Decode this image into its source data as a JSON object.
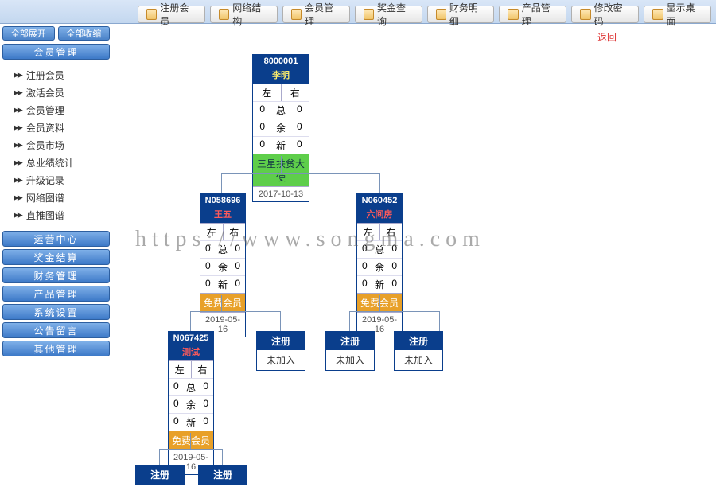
{
  "top": [
    "注册会员",
    "网络结构",
    "会员管理",
    "奖金查询",
    "财务明细",
    "产品管理",
    "修改密码",
    "显示桌面"
  ],
  "expand": "全部展开",
  "collapse": "全部收缩",
  "sec1": "会员管理",
  "menu1": [
    "注册会员",
    "激活会员",
    "会员管理",
    "会员资料",
    "会员市场",
    "总业绩统计",
    "升级记录",
    "网络图谱",
    "直推图谱"
  ],
  "sec2": "运营中心",
  "menu2": [
    "奖金结算",
    "财务管理",
    "产品管理",
    "系统设置",
    "公告留言",
    "其他管理"
  ],
  "back": "返回",
  "lbl": {
    "left": "左",
    "right": "右",
    "zong": "总",
    "yu": "余",
    "xin": "新",
    "reg": "注册",
    "nojoin": "未加入"
  },
  "root": {
    "id": "8000001",
    "name": "李明",
    "l0": "0",
    "r0": "0",
    "l1": "0",
    "r1": "0",
    "l2": "0",
    "r2": "0",
    "level": "三星扶贫大使",
    "date": "2017-10-13"
  },
  "n1": {
    "id": "N058696",
    "name": "王五",
    "l0": "0",
    "m0": "总",
    "r0": "0",
    "l1": "0",
    "m1": "余",
    "r1": "0",
    "l2": "0",
    "m2": "新",
    "r2": "0",
    "level": "免费会员",
    "date": "2019-05-16"
  },
  "n2": {
    "id": "N060452",
    "name": "六间房",
    "date": "2019-05-16",
    "level": "免费会员"
  },
  "n3": {
    "id": "N067425",
    "name": "测试",
    "date": "2019-05-16",
    "level": "免费会员"
  },
  "watermark": "https://www.songma.com"
}
